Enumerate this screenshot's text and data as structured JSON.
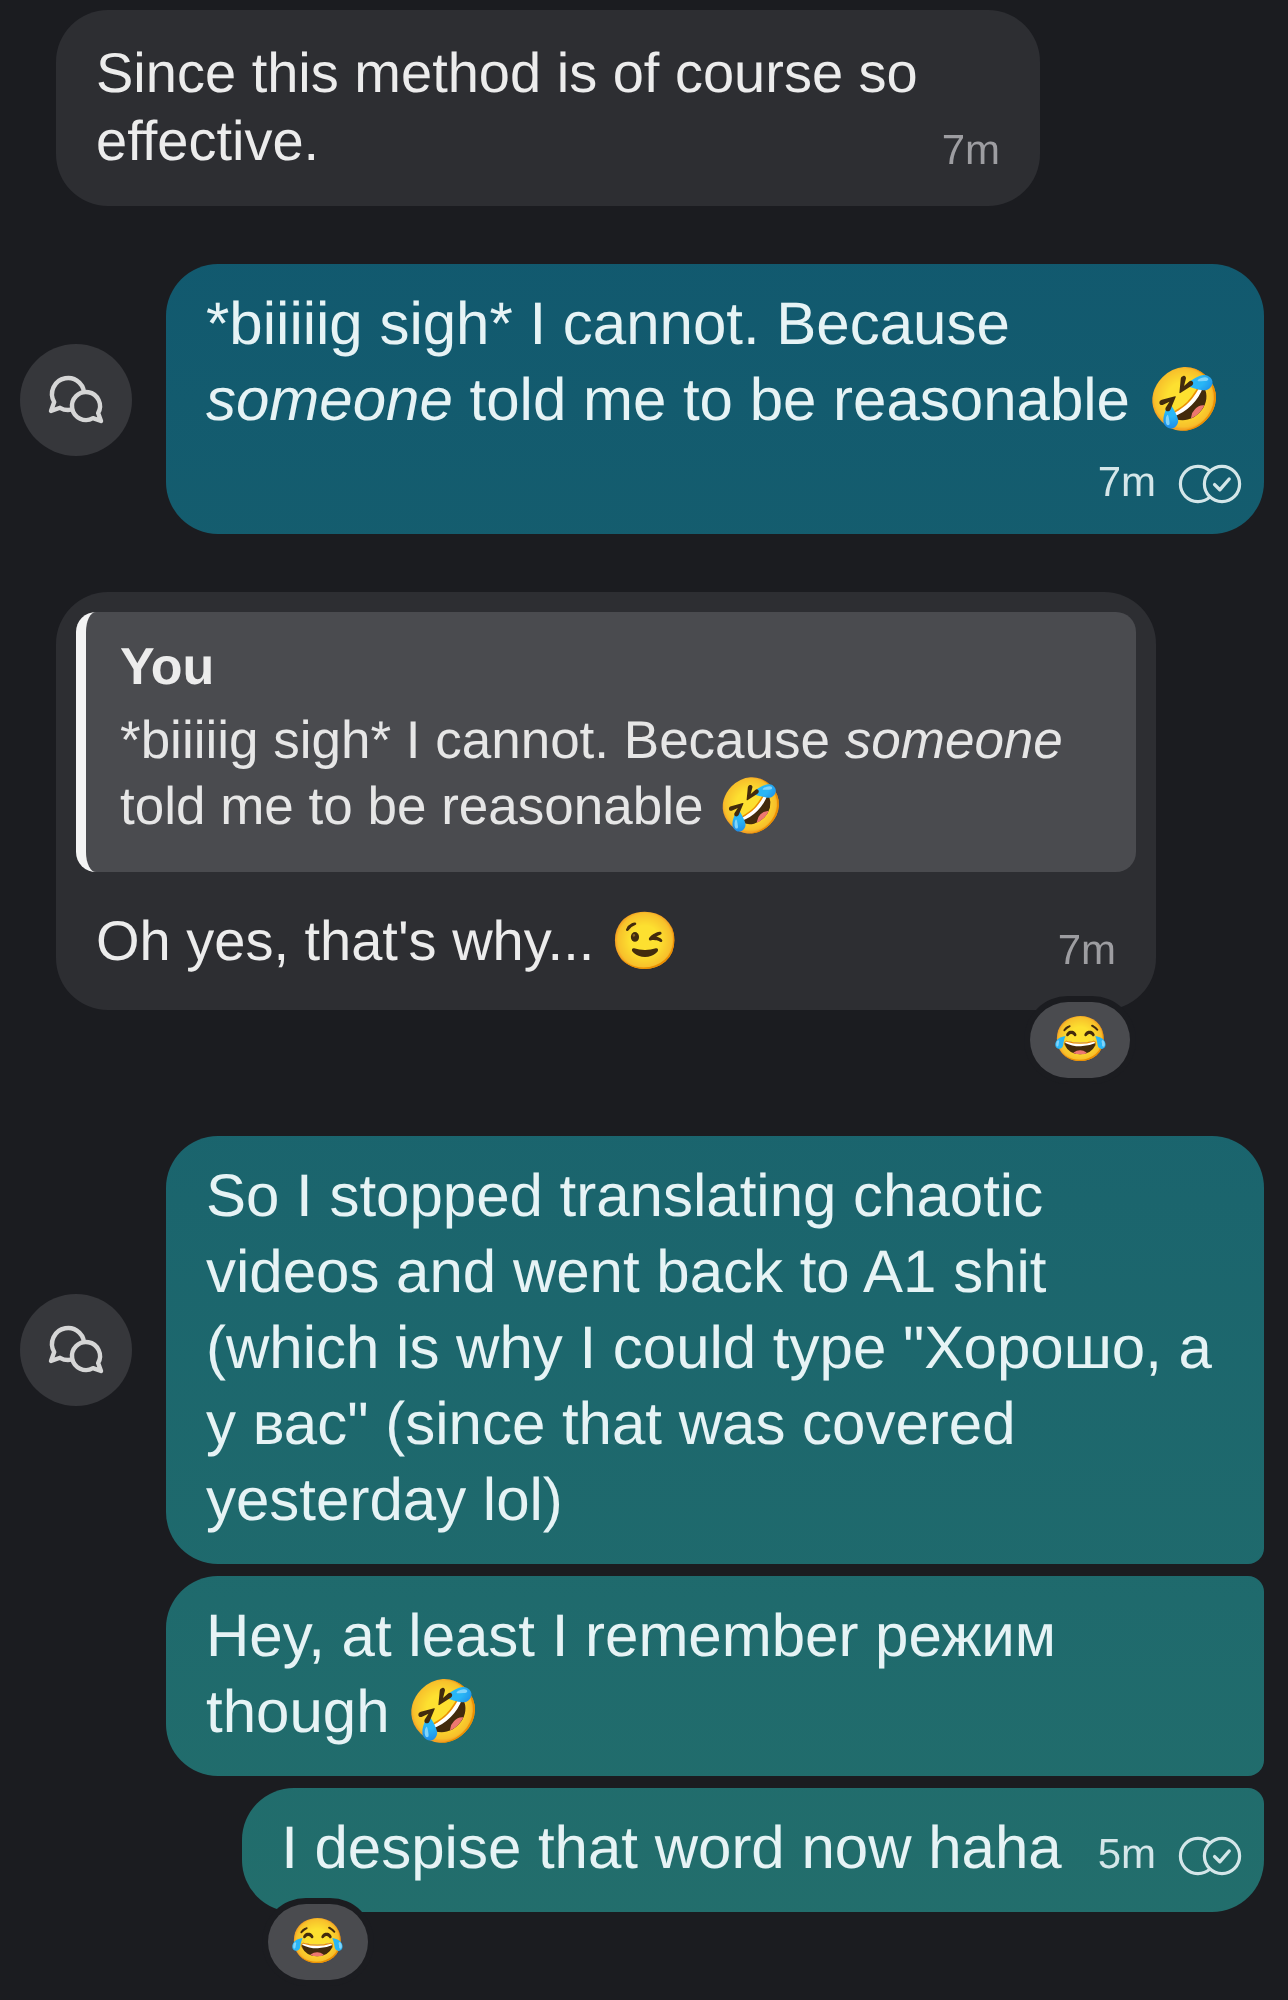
{
  "messages": [
    {
      "kind": "incoming",
      "body": [
        {
          "text": "Since this method is of course so effective.",
          "italic": false
        }
      ],
      "time": "7m"
    },
    {
      "kind": "outgoing",
      "side_icon": true,
      "body": [
        {
          "text": "*biiiiig sigh* I cannot. Because ",
          "italic": false
        },
        {
          "text": "someone",
          "italic": true
        },
        {
          "text": " told me to be reasonable 🤣",
          "italic": false
        }
      ],
      "time": "7m",
      "delivered": true
    },
    {
      "kind": "incoming",
      "quote": {
        "author": "You",
        "body": [
          {
            "text": "*biiiiig sigh* I cannot. Because ",
            "italic": false
          },
          {
            "text": "someone",
            "italic": true
          },
          {
            "text": " told me to be reasonable 🤣",
            "italic": false
          }
        ]
      },
      "body": [
        {
          "text": "Oh yes, that's why... 😉",
          "italic": false
        }
      ],
      "time": "7m",
      "reaction": "😂"
    },
    {
      "kind": "outgoing",
      "side_icon": true,
      "body": [
        {
          "text": "So I stopped translating chaotic videos and went back to A1 shit (which is why I could type \"Хорошо, а у вас\" (since that was covered yesterday lol)",
          "italic": false
        }
      ]
    },
    {
      "kind": "outgoing",
      "body": [
        {
          "text": "Hey, at least I remember режим though 🤣",
          "italic": false
        }
      ]
    },
    {
      "kind": "outgoing",
      "body": [
        {
          "text": "I despise that word now haha",
          "italic": false
        }
      ],
      "time": "5m",
      "delivered": true,
      "reaction": "😂"
    }
  ]
}
